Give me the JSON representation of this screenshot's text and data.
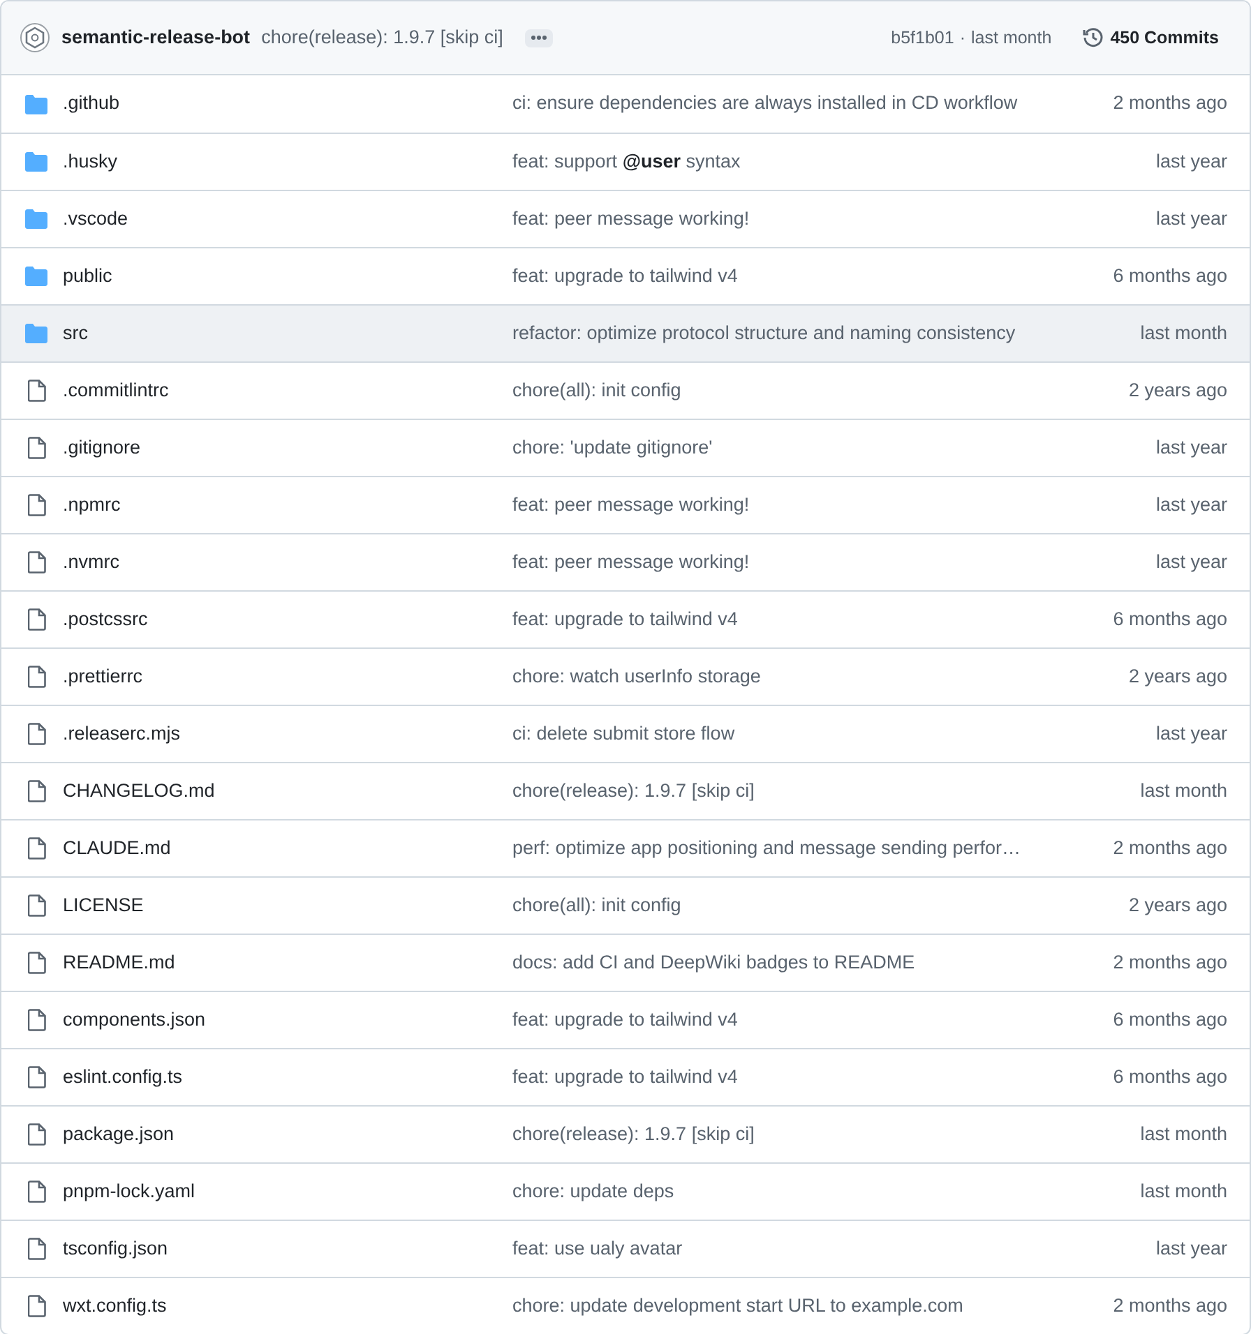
{
  "latest_commit": {
    "author": "semantic-release-bot",
    "message": "chore(release): 1.9.7 [skip ci]",
    "hash": "b5f1b01",
    "separator": "·",
    "time": "last month",
    "commits": "450 Commits"
  },
  "files": [
    {
      "kind": "folder",
      "name": ".github",
      "message": "ci: ensure dependencies are always installed in CD workflow",
      "time": "2 months ago",
      "highlighted": false
    },
    {
      "kind": "folder",
      "name": ".husky",
      "message": "feat: support **@user** syntax",
      "time": "last year",
      "highlighted": false
    },
    {
      "kind": "folder",
      "name": ".vscode",
      "message": "feat: peer message working!",
      "time": "last year",
      "highlighted": false
    },
    {
      "kind": "folder",
      "name": "public",
      "message": "feat: upgrade to tailwind v4",
      "time": "6 months ago",
      "highlighted": false
    },
    {
      "kind": "folder",
      "name": "src",
      "message": "refactor: optimize protocol structure and naming consistency",
      "time": "last month",
      "highlighted": true
    },
    {
      "kind": "file",
      "name": ".commitlintrc",
      "message": "chore(all): init config",
      "time": "2 years ago",
      "highlighted": false
    },
    {
      "kind": "file",
      "name": ".gitignore",
      "message": "chore: 'update gitignore'",
      "time": "last year",
      "highlighted": false
    },
    {
      "kind": "file",
      "name": ".npmrc",
      "message": "feat: peer message working!",
      "time": "last year",
      "highlighted": false
    },
    {
      "kind": "file",
      "name": ".nvmrc",
      "message": "feat: peer message working!",
      "time": "last year",
      "highlighted": false
    },
    {
      "kind": "file",
      "name": ".postcssrc",
      "message": "feat: upgrade to tailwind v4",
      "time": "6 months ago",
      "highlighted": false
    },
    {
      "kind": "file",
      "name": ".prettierrc",
      "message": "chore: watch userInfo storage",
      "time": "2 years ago",
      "highlighted": false
    },
    {
      "kind": "file",
      "name": ".releaserc.mjs",
      "message": "ci: delete submit store flow",
      "time": "last year",
      "highlighted": false
    },
    {
      "kind": "file",
      "name": "CHANGELOG.md",
      "message": "chore(release): 1.9.7 [skip ci]",
      "time": "last month",
      "highlighted": false
    },
    {
      "kind": "file",
      "name": "CLAUDE.md",
      "message": "perf: optimize app positioning and message sending perfor…",
      "time": "2 months ago",
      "highlighted": false
    },
    {
      "kind": "file",
      "name": "LICENSE",
      "message": "chore(all): init config",
      "time": "2 years ago",
      "highlighted": false
    },
    {
      "kind": "file",
      "name": "README.md",
      "message": "docs: add CI and DeepWiki badges to README",
      "time": "2 months ago",
      "highlighted": false
    },
    {
      "kind": "file",
      "name": "components.json",
      "message": "feat: upgrade to tailwind v4",
      "time": "6 months ago",
      "highlighted": false
    },
    {
      "kind": "file",
      "name": "eslint.config.ts",
      "message": "feat: upgrade to tailwind v4",
      "time": "6 months ago",
      "highlighted": false
    },
    {
      "kind": "file",
      "name": "package.json",
      "message": "chore(release): 1.9.7 [skip ci]",
      "time": "last month",
      "highlighted": false
    },
    {
      "kind": "file",
      "name": "pnpm-lock.yaml",
      "message": "chore: update deps",
      "time": "last month",
      "highlighted": false
    },
    {
      "kind": "file",
      "name": "tsconfig.json",
      "message": "feat: use ualy avatar",
      "time": "last year",
      "highlighted": false
    },
    {
      "kind": "file",
      "name": "wxt.config.ts",
      "message": "chore: update development start URL to example.com",
      "time": "2 months ago",
      "highlighted": false
    }
  ]
}
